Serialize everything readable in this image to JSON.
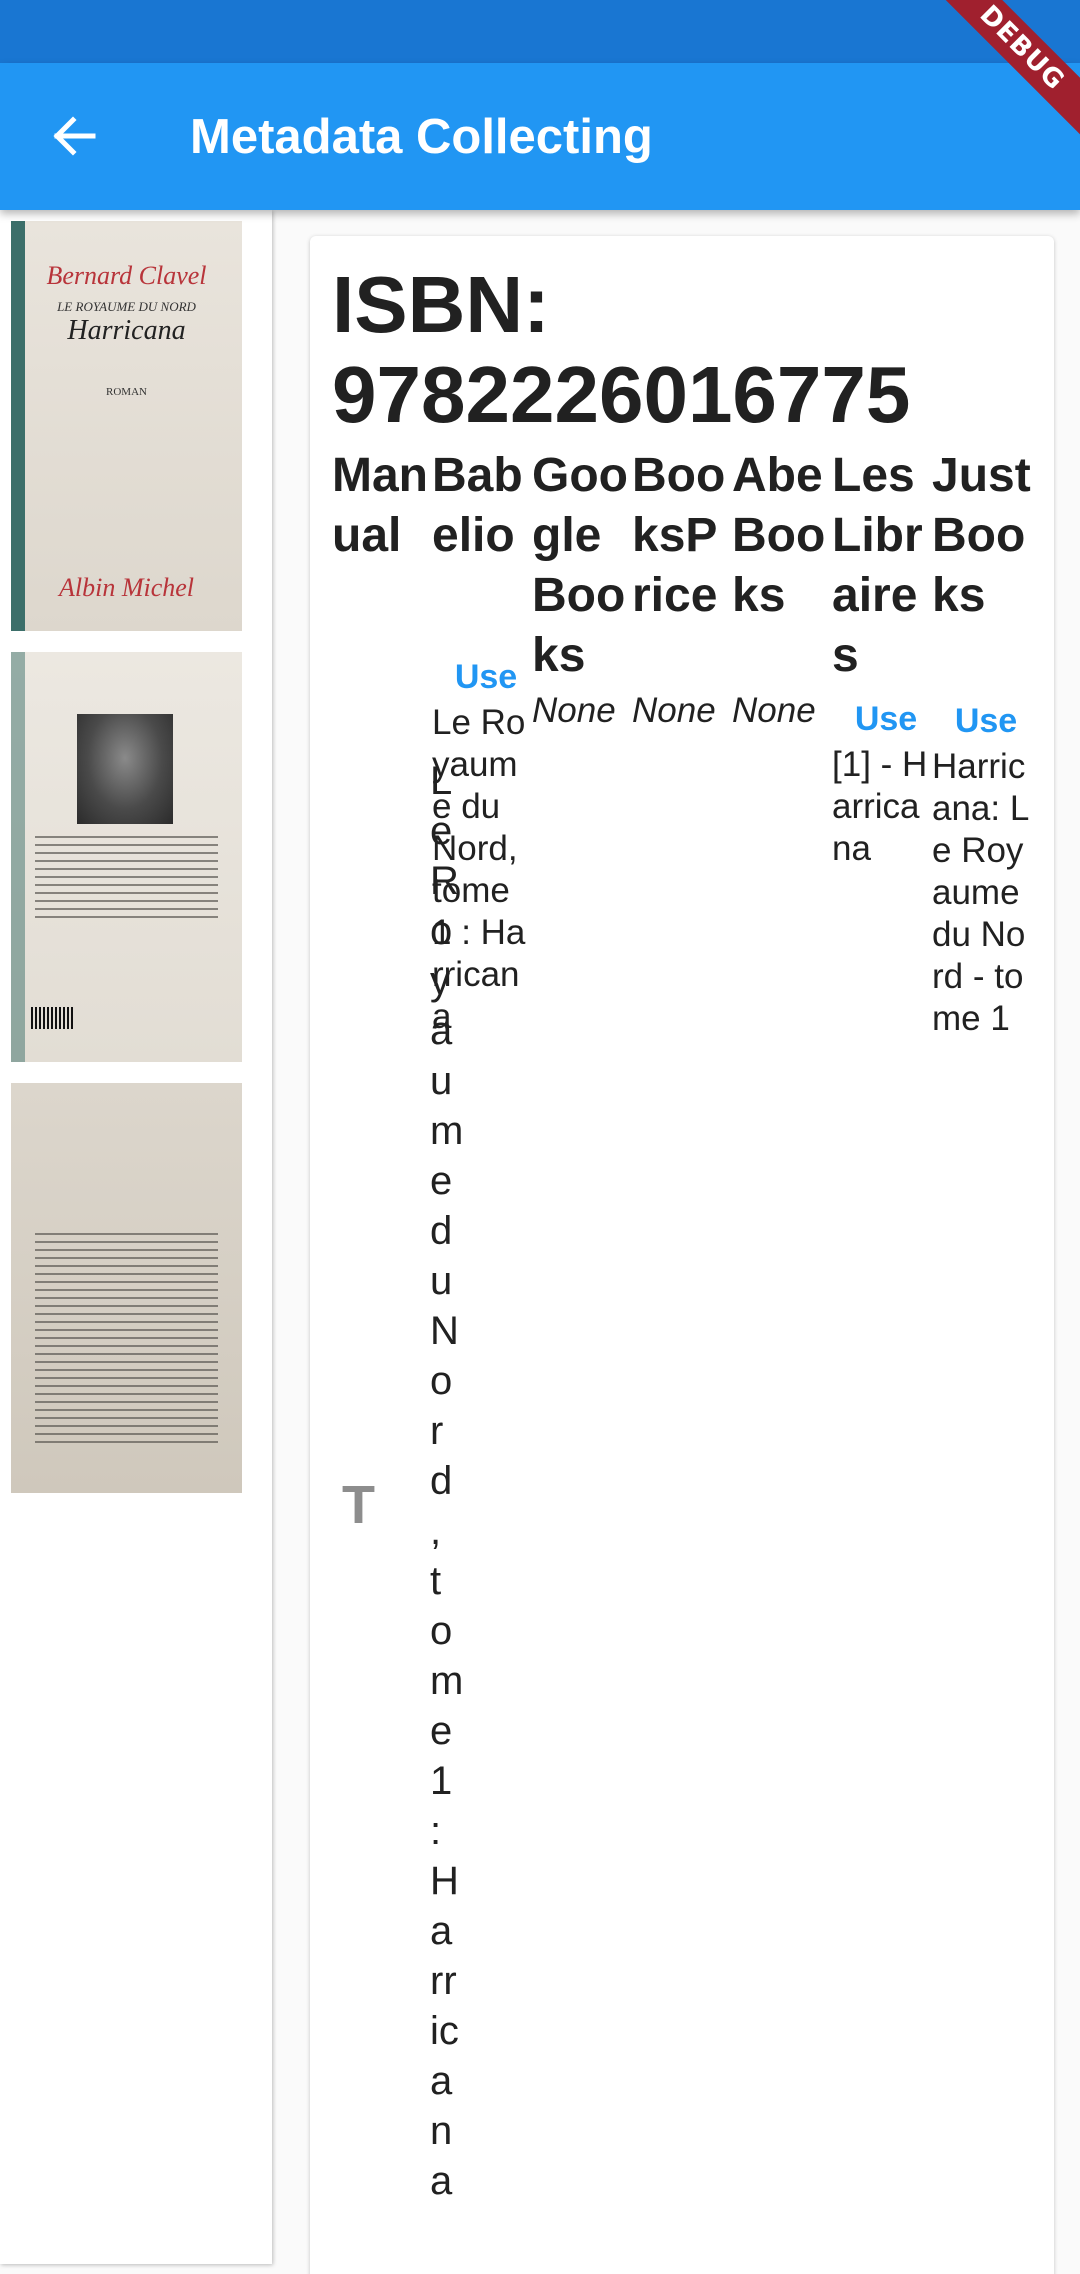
{
  "app_bar": {
    "back_icon": "arrow-back-icon",
    "title": "Metadata Collecting",
    "debug_banner": "DEBUG",
    "color": "#2196f3",
    "status_color": "#1976d2"
  },
  "images": {
    "cover": {
      "author": "Bernard Clavel",
      "series": "LE ROYAUME DU NORD",
      "title": "Harricana",
      "genre": "ROMAN",
      "publisher": "Albin Michel"
    }
  },
  "isbn_label": "ISBN: 9782226016775",
  "columns": [
    {
      "header": "Manual"
    },
    {
      "header": "Babelio",
      "use_label": "Use",
      "value": "Le Royaume du Nord, tome 1 : Harricana"
    },
    {
      "header": "GoogleBooks",
      "status": "None"
    },
    {
      "header": "BooksPrice",
      "status": "None"
    },
    {
      "header": "AbeBooks",
      "status": "None"
    },
    {
      "header": "LesLibraires",
      "use_label": "Use",
      "value": "[1] - Harricana"
    },
    {
      "header": "JustBooks",
      "use_label": "Use",
      "value": "Harricana: Le Royaume du Nord - tome 1"
    }
  ],
  "manual_field": {
    "icon": "text-field-icon",
    "icon_glyph": "T",
    "value": "Le Royaume du Nord, tome 1 : Harricana"
  },
  "link_color": "#2196f3"
}
